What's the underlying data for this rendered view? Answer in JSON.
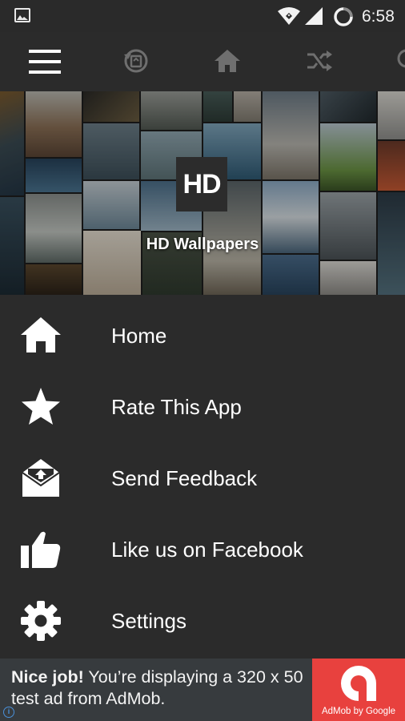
{
  "status_bar": {
    "time": "6:58",
    "icons": [
      "gallery-icon",
      "wifi-icon",
      "signal-icon",
      "sync-icon"
    ]
  },
  "toolbar": {
    "icons": [
      "menu-icon",
      "history-icon",
      "home-icon",
      "shuffle-icon",
      "search-icon"
    ]
  },
  "header": {
    "logo_text": "HD",
    "app_title": "HD Wallpapers"
  },
  "menu": {
    "items": [
      {
        "label": "Home",
        "icon": "home-icon"
      },
      {
        "label": "Rate This App",
        "icon": "star-icon"
      },
      {
        "label": "Send Feedback",
        "icon": "feedback-mail-icon"
      },
      {
        "label": "Like us on Facebook",
        "icon": "thumbs-up-icon"
      },
      {
        "label": "Settings",
        "icon": "gear-icon"
      }
    ]
  },
  "ad": {
    "headline": "Nice job!",
    "body": " You’re displaying a 320 x 50 test ad from AdMob.",
    "badge_caption": "AdMob by Google",
    "colors": {
      "badge": "#e8413e",
      "banner": "#373b3e"
    }
  }
}
